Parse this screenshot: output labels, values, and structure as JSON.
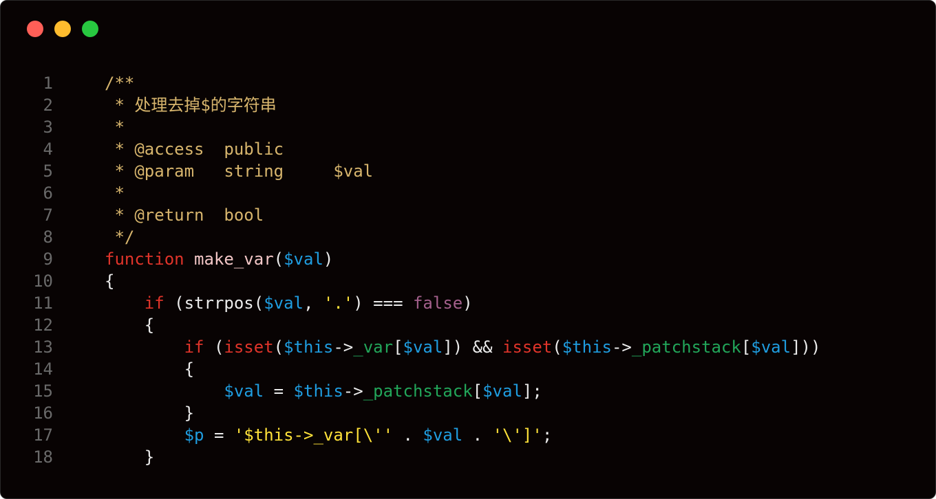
{
  "window": {
    "controls": [
      {
        "name": "close-button",
        "color": "#fe5f57"
      },
      {
        "name": "minimize-button",
        "color": "#febc2e"
      },
      {
        "name": "zoom-button",
        "color": "#28c840"
      }
    ]
  },
  "code_lines": [
    {
      "n": "1",
      "tokens": [
        {
          "t": "/**",
          "c": "comment"
        }
      ]
    },
    {
      "n": "2",
      "tokens": [
        {
          "t": " * 处理去掉$的字符串",
          "c": "comment"
        }
      ]
    },
    {
      "n": "3",
      "tokens": [
        {
          "t": " *",
          "c": "comment"
        }
      ]
    },
    {
      "n": "4",
      "tokens": [
        {
          "t": " * @access  public",
          "c": "comment"
        }
      ]
    },
    {
      "n": "5",
      "tokens": [
        {
          "t": " * @param   string     $val",
          "c": "comment"
        }
      ]
    },
    {
      "n": "6",
      "tokens": [
        {
          "t": " *",
          "c": "comment"
        }
      ]
    },
    {
      "n": "7",
      "tokens": [
        {
          "t": " * @return  bool",
          "c": "comment"
        }
      ]
    },
    {
      "n": "8",
      "tokens": [
        {
          "t": " */",
          "c": "comment"
        }
      ]
    },
    {
      "n": "9",
      "tokens": [
        {
          "t": "function",
          "c": "keyword"
        },
        {
          "t": " ",
          "c": "plain"
        },
        {
          "t": "make_var",
          "c": "func"
        },
        {
          "t": "(",
          "c": "plain"
        },
        {
          "t": "$val",
          "c": "var"
        },
        {
          "t": ")",
          "c": "plain"
        }
      ]
    },
    {
      "n": "10",
      "tokens": [
        {
          "t": "{",
          "c": "plain"
        }
      ]
    },
    {
      "n": "11",
      "tokens": [
        {
          "t": "    ",
          "c": "plain"
        },
        {
          "t": "if",
          "c": "keyword"
        },
        {
          "t": " (strrpos(",
          "c": "plain"
        },
        {
          "t": "$val",
          "c": "var"
        },
        {
          "t": ", ",
          "c": "plain"
        },
        {
          "t": "'.'",
          "c": "string"
        },
        {
          "t": ") === ",
          "c": "plain"
        },
        {
          "t": "false",
          "c": "bool"
        },
        {
          "t": ")",
          "c": "plain"
        }
      ]
    },
    {
      "n": "12",
      "tokens": [
        {
          "t": "    {",
          "c": "plain"
        }
      ]
    },
    {
      "n": "13",
      "tokens": [
        {
          "t": "        ",
          "c": "plain"
        },
        {
          "t": "if",
          "c": "keyword"
        },
        {
          "t": " (",
          "c": "plain"
        },
        {
          "t": "isset",
          "c": "keyword"
        },
        {
          "t": "(",
          "c": "plain"
        },
        {
          "t": "$this",
          "c": "var"
        },
        {
          "t": "->",
          "c": "plain"
        },
        {
          "t": "_var",
          "c": "prop"
        },
        {
          "t": "[",
          "c": "plain"
        },
        {
          "t": "$val",
          "c": "var"
        },
        {
          "t": "]) && ",
          "c": "plain"
        },
        {
          "t": "isset",
          "c": "keyword"
        },
        {
          "t": "(",
          "c": "plain"
        },
        {
          "t": "$this",
          "c": "var"
        },
        {
          "t": "->",
          "c": "plain"
        },
        {
          "t": "_patchstack",
          "c": "prop"
        },
        {
          "t": "[",
          "c": "plain"
        },
        {
          "t": "$val",
          "c": "var"
        },
        {
          "t": "]))",
          "c": "plain"
        }
      ]
    },
    {
      "n": "14",
      "tokens": [
        {
          "t": "        {",
          "c": "plain"
        }
      ]
    },
    {
      "n": "15",
      "tokens": [
        {
          "t": "            ",
          "c": "plain"
        },
        {
          "t": "$val",
          "c": "var"
        },
        {
          "t": " = ",
          "c": "plain"
        },
        {
          "t": "$this",
          "c": "var"
        },
        {
          "t": "->",
          "c": "plain"
        },
        {
          "t": "_patchstack",
          "c": "prop"
        },
        {
          "t": "[",
          "c": "plain"
        },
        {
          "t": "$val",
          "c": "var"
        },
        {
          "t": "];",
          "c": "plain"
        }
      ]
    },
    {
      "n": "16",
      "tokens": [
        {
          "t": "        }",
          "c": "plain"
        }
      ]
    },
    {
      "n": "17",
      "tokens": [
        {
          "t": "        ",
          "c": "plain"
        },
        {
          "t": "$p",
          "c": "var"
        },
        {
          "t": " = ",
          "c": "plain"
        },
        {
          "t": "'$this->_var[\\''",
          "c": "string"
        },
        {
          "t": " . ",
          "c": "plain"
        },
        {
          "t": "$val",
          "c": "var"
        },
        {
          "t": " . ",
          "c": "plain"
        },
        {
          "t": "'\\']'",
          "c": "string"
        },
        {
          "t": ";",
          "c": "plain"
        }
      ]
    },
    {
      "n": "18",
      "tokens": [
        {
          "t": "    }",
          "c": "plain"
        }
      ]
    }
  ]
}
